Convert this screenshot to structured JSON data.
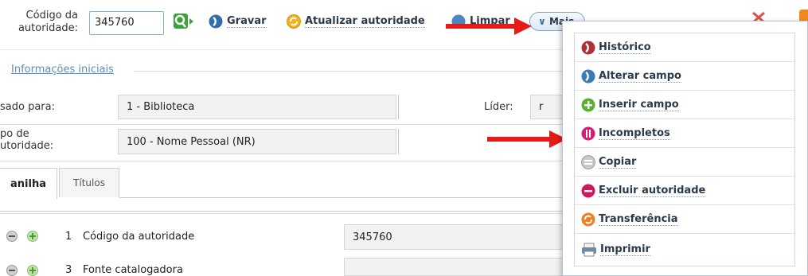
{
  "toolbar": {
    "code_label": "Código da autoridade:",
    "code_value": "345760",
    "gravar": "Gravar",
    "atualizar": "Atualizar autoridade",
    "limpar": "Limpar",
    "mais": "Mais"
  },
  "form": {
    "section_title": "Informações iniciais",
    "usado_para_label": "sado para:",
    "usado_para_value": "1 - Biblioteca",
    "lider_label": "Líder:",
    "lider_value": "r",
    "tipo_label": "po de utoridade:",
    "tipo_value": "100 - Nome Pessoal (NR)"
  },
  "tabs": [
    {
      "label": "anilha",
      "active": true
    },
    {
      "label": "Títulos",
      "active": false
    }
  ],
  "rows": [
    {
      "num": "1",
      "label": "Código da autoridade",
      "value": "345760"
    },
    {
      "num": "3",
      "label": "Fonte catalogadora",
      "value": ""
    }
  ],
  "menu": {
    "items": [
      {
        "label": "Histórico",
        "icon": "history-icon",
        "color": "#b0303a"
      },
      {
        "label": "Alterar campo",
        "icon": "alter-field-icon",
        "color": "#3a7ab8"
      },
      {
        "label": "Inserir campo",
        "icon": "insert-field-icon",
        "color": "#5bb030"
      },
      {
        "label": "Incompletos",
        "icon": "incomplete-icon",
        "color": "#d0207a"
      },
      {
        "label": "Copiar",
        "icon": "copy-icon",
        "color": "#a0a0a0"
      },
      {
        "label": "Excluir autoridade",
        "icon": "delete-icon",
        "color": "#d01860"
      },
      {
        "label": "Transferência",
        "icon": "transfer-icon",
        "color": "#f08020"
      },
      {
        "label": "Imprimir",
        "icon": "printer-icon",
        "color": "#6a8aa8"
      }
    ]
  },
  "colors": {
    "arrow": "#e51b17",
    "link": "#5a8fbd",
    "button_text": "#2b3a4a"
  }
}
